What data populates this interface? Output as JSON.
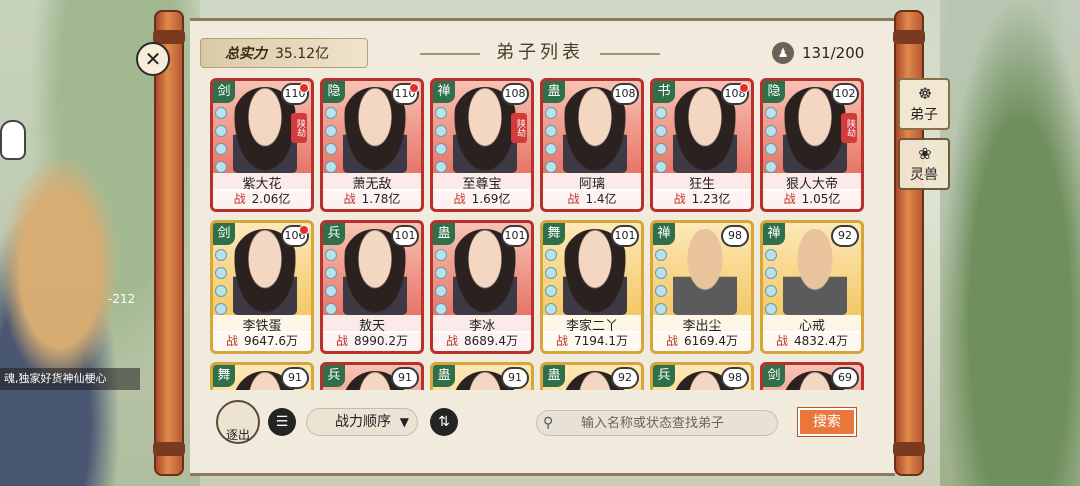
{
  "header": {
    "total_power_label": "总实力",
    "total_power_value": "35.12亿",
    "title": "弟子列表",
    "count": "131/200"
  },
  "cards": [
    {
      "sect": "剑",
      "level": "110",
      "name": "紫大花",
      "power": "2.06亿",
      "tag": "陕劫",
      "frame": "red",
      "dot": true
    },
    {
      "sect": "隐",
      "level": "110",
      "name": "萧无敌",
      "power": "1.78亿",
      "tag": "",
      "frame": "red",
      "dot": true
    },
    {
      "sect": "禅",
      "level": "108",
      "name": "至尊宝",
      "power": "1.69亿",
      "tag": "陕劫",
      "frame": "red",
      "dot": false
    },
    {
      "sect": "蛊",
      "level": "108",
      "name": "阿璃",
      "power": "1.4亿",
      "tag": "",
      "frame": "red",
      "dot": false
    },
    {
      "sect": "书",
      "level": "108",
      "name": "狂生",
      "power": "1.23亿",
      "tag": "",
      "frame": "red",
      "dot": true
    },
    {
      "sect": "隐",
      "level": "102",
      "name": "狠人大帝",
      "power": "1.05亿",
      "tag": "陕劫",
      "frame": "red",
      "dot": false
    },
    {
      "sect": "剑",
      "level": "106",
      "name": "李铁蛋",
      "power": "9647.6万",
      "tag": "",
      "frame": "gold",
      "dot": true
    },
    {
      "sect": "兵",
      "level": "101",
      "name": "敖天",
      "power": "8990.2万",
      "tag": "",
      "frame": "red",
      "dot": false
    },
    {
      "sect": "蛊",
      "level": "101",
      "name": "李冰",
      "power": "8689.4万",
      "tag": "",
      "frame": "red",
      "dot": false
    },
    {
      "sect": "舞",
      "level": "101",
      "name": "李家二丫",
      "power": "7194.1万",
      "tag": "",
      "frame": "gold",
      "dot": false
    },
    {
      "sect": "禅",
      "level": "98",
      "name": "李出尘",
      "power": "6169.4万",
      "tag": "",
      "frame": "gold",
      "dot": false,
      "bald": true
    },
    {
      "sect": "禅",
      "level": "92",
      "name": "心戒",
      "power": "4832.4万",
      "tag": "",
      "frame": "gold",
      "dot": false,
      "bald": true
    },
    {
      "sect": "舞",
      "level": "91",
      "name": "",
      "power": "",
      "tag": "",
      "frame": "gold",
      "dot": false
    },
    {
      "sect": "兵",
      "level": "91",
      "name": "",
      "power": "",
      "tag": "",
      "frame": "red",
      "dot": false
    },
    {
      "sect": "蛊",
      "level": "91",
      "name": "",
      "power": "",
      "tag": "",
      "frame": "gold",
      "dot": false
    },
    {
      "sect": "蛊",
      "level": "92",
      "name": "",
      "power": "",
      "tag": "",
      "frame": "gold",
      "dot": false
    },
    {
      "sect": "兵",
      "level": "98",
      "name": "",
      "power": "",
      "tag": "",
      "frame": "gold",
      "dot": false
    },
    {
      "sect": "剑",
      "level": "69",
      "name": "",
      "power": "",
      "tag": "",
      "frame": "red",
      "dot": false
    }
  ],
  "power_prefix": "战",
  "bottom": {
    "exit_label": "逐出",
    "sort_label": "战力顺序",
    "search_placeholder": "输入名称或状态查找弟子",
    "search_button": "搜索"
  },
  "side_tabs": [
    {
      "label": "弟子",
      "active": true
    },
    {
      "label": "灵兽",
      "active": false
    }
  ],
  "background": {
    "banner_text": "魂,独家好货神仙梗心",
    "number_text": "-212"
  },
  "colors": {
    "red_frame": "#b8302c",
    "gold_frame": "#d7a63a",
    "search_button": "#e9773c"
  }
}
